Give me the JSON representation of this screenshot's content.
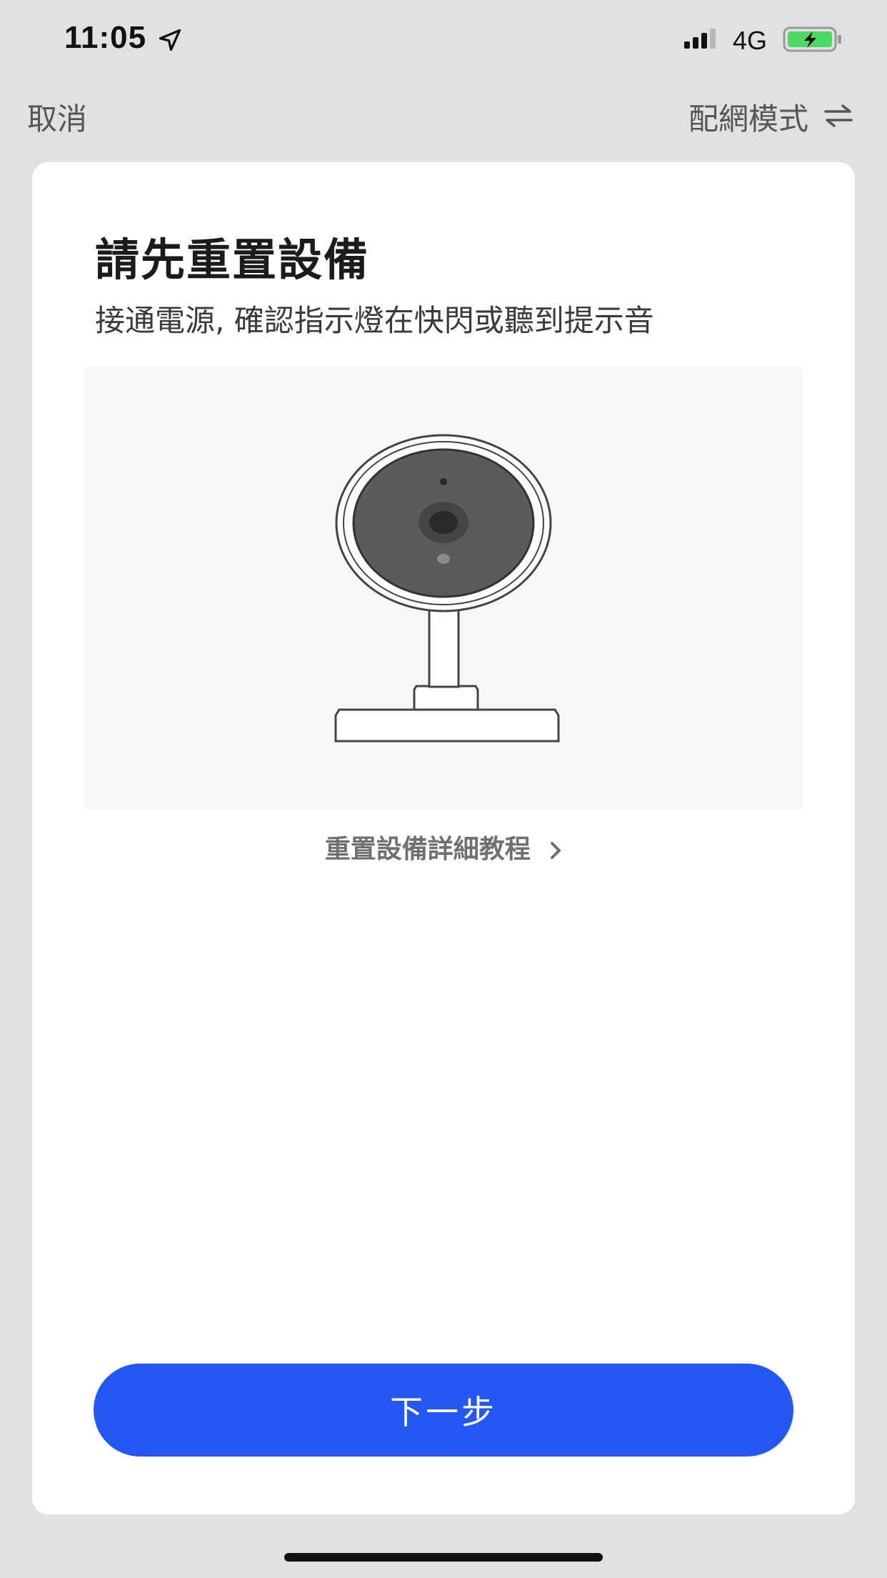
{
  "status_bar": {
    "time": "11:05",
    "network": "4G",
    "icons": [
      "location-arrow-icon",
      "signal-icon",
      "battery-charging-icon"
    ],
    "battery_color": "#4cd964"
  },
  "nav": {
    "cancel_label": "取消",
    "mode_label": "配網模式",
    "mode_icon": "swap-arrows-icon"
  },
  "card": {
    "title": "請先重置設備",
    "subtitle": "接通電源, 確認指示燈在快閃或聽到提示音",
    "illustration_icon": "camera-illustration",
    "tutorial_link": "重置設備詳細教程",
    "next_button": "下一步"
  },
  "colors": {
    "accent": "#2457f5",
    "background": "#e1e1e4",
    "card": "#ffffff"
  }
}
